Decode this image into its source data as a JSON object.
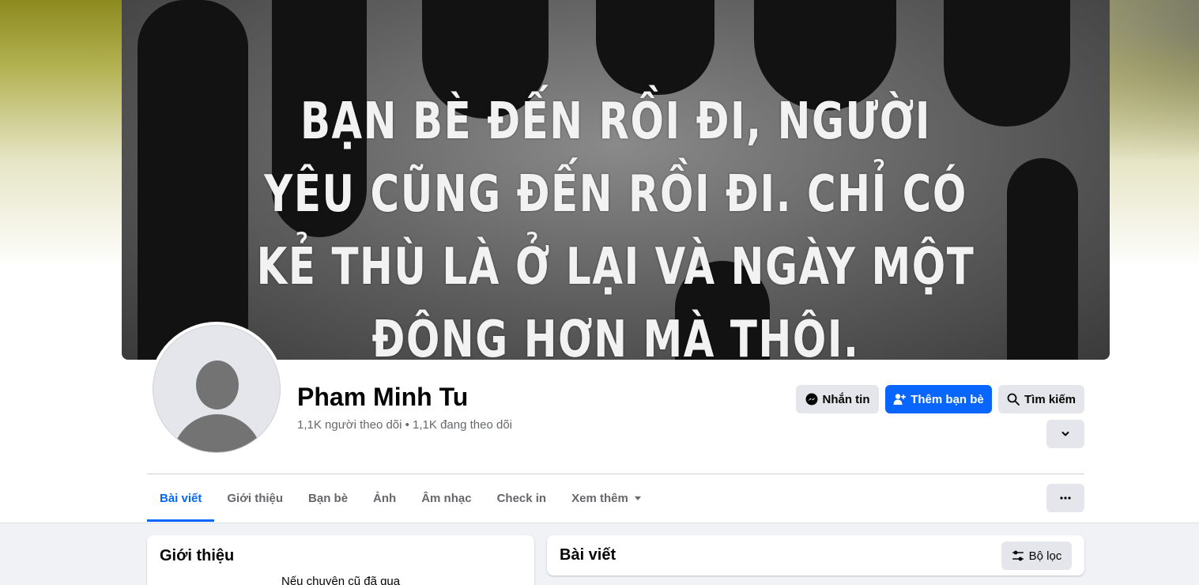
{
  "cover": {
    "lines": [
      "BẠN BÈ ĐẾN RỒI ĐI, NGƯỜI",
      "YÊU CŨNG ĐẾN RỒI ĐI. CHỈ CÓ",
      "KẺ THÙ LÀ Ở LẠI VÀ NGÀY MỘT",
      "ĐÔNG HƠN MÀ THÔI."
    ]
  },
  "profile": {
    "name": "Pham Minh Tu",
    "stats": "1,1K người theo dõi • 1,1K đang theo dõi"
  },
  "actions": {
    "message_label": "Nhắn tin",
    "add_friend_label": "Thêm bạn bè",
    "search_label": "Tìm kiếm"
  },
  "tabs": [
    {
      "label": "Bài viết",
      "active": true
    },
    {
      "label": "Giới thiệu"
    },
    {
      "label": "Bạn bè"
    },
    {
      "label": "Ảnh"
    },
    {
      "label": "Âm nhạc"
    },
    {
      "label": "Check in"
    },
    {
      "label": "Xem thêm"
    }
  ],
  "intro": {
    "title": "Giới thiệu",
    "bio": "Nếu chuyện cũ đã qua"
  },
  "posts": {
    "title": "Bài viết",
    "filter_label": "Bộ lọc"
  },
  "colors": {
    "accent": "#0866ff",
    "button_gray": "#e4e6eb",
    "feed_bg": "#f0f2f5"
  }
}
